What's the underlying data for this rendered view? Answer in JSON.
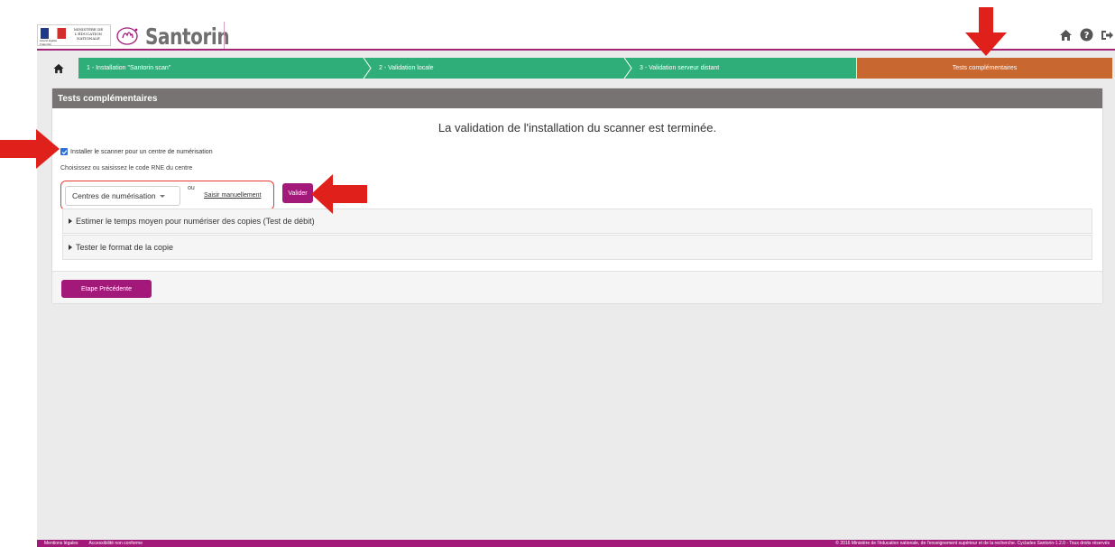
{
  "header": {
    "ministry_text": "MINISTÈRE DE L'ÉDUCATION NATIONALE",
    "ministry_motto": "Liberté Égalité Fraternité",
    "brand": "Santorin",
    "icons": [
      "home-icon",
      "help-icon",
      "logout-icon",
      "window-icon"
    ]
  },
  "stepper": {
    "home_icon": "home-icon",
    "steps": [
      {
        "label": "1 - Installation \"Santorin scan\""
      },
      {
        "label": "2 - Validation locale"
      },
      {
        "label": "3 - Validation serveur distant"
      }
    ],
    "active": "Tests complémentaires"
  },
  "panel": {
    "title": "Tests complémentaires",
    "headline": "La validation de l'installation du scanner est terminée.",
    "checkbox_label": "Installer le scanner pour un centre de numérisation",
    "checkbox_checked": true,
    "help_text": "Choisissez ou saisissez le code RNE du centre",
    "select_value": "Centres de numérisation",
    "or_text": "ou",
    "manual_link": "Saisir manuellement",
    "validate_label": "Valider",
    "accordions": [
      {
        "label": "Estimer le temps moyen pour numériser des copies (Test de débit)"
      },
      {
        "label": "Tester le format de la copie"
      }
    ],
    "prev_label": "Etape Précédente"
  },
  "footer": {
    "legal": "Mentions légales",
    "accessibility": "Accessibilité non conforme",
    "copyright": "© 2016 Ministère de l'éducation nationale, de l'enseignement supérieur et de la recherche. Cyclades Santorin-1.2.0 - Tous droits réservés"
  },
  "colors": {
    "accent": "#a3197a",
    "step_green": "#2fae7a",
    "step_active": "#c8672f",
    "panel_header": "#767372",
    "annotation_red": "#e0211b"
  }
}
